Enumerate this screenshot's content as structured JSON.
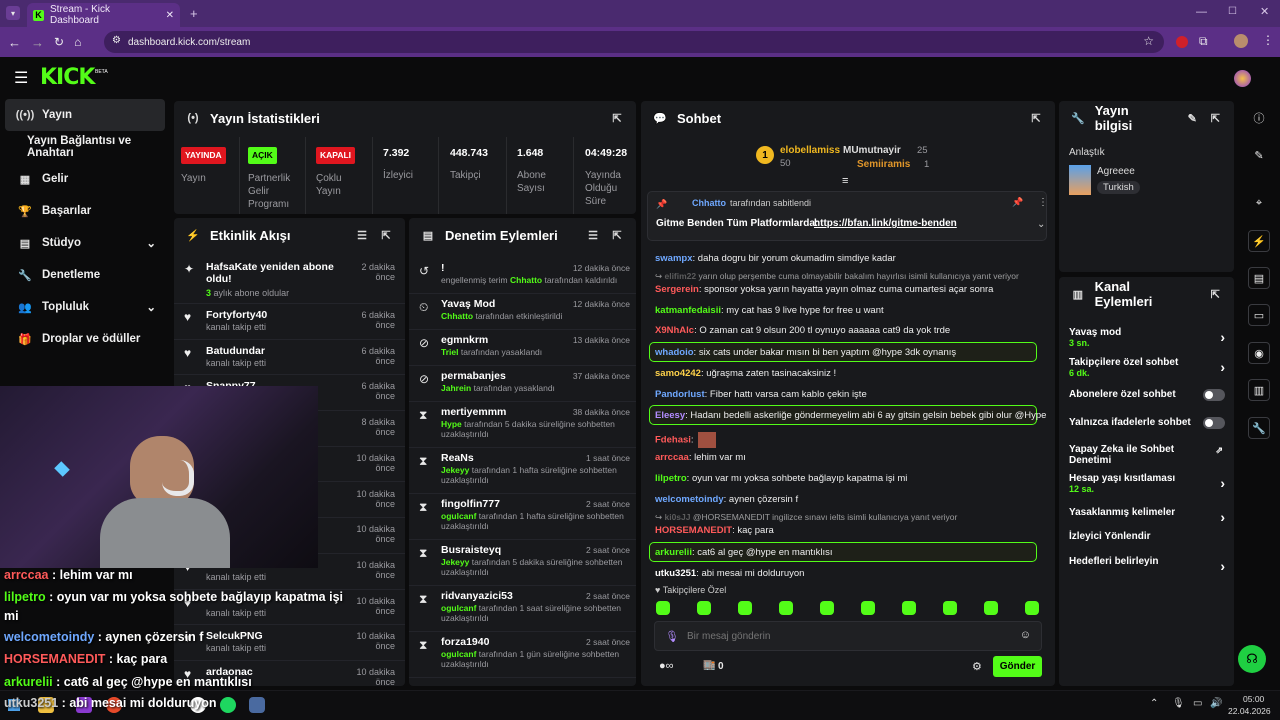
{
  "browser": {
    "tab_title": "Stream - Kick Dashboard",
    "url": "dashboard.kick.com/stream"
  },
  "header": {
    "logo": "KICK",
    "beta": "BETA"
  },
  "sidebar": {
    "items": [
      {
        "label": "Yayın",
        "icon": "broadcast-icon",
        "active": true
      },
      {
        "label": "Yayın Bağlantısı ve Anahtarı",
        "icon": "",
        "active": false
      },
      {
        "label": "Gelir",
        "icon": "revenue-icon"
      },
      {
        "label": "Başarılar",
        "icon": "trophy-icon"
      },
      {
        "label": "Stüdyo",
        "icon": "studio-icon"
      },
      {
        "label": "Denetleme",
        "icon": "wrench-icon"
      },
      {
        "label": "Topluluk",
        "icon": "community-icon"
      },
      {
        "label": "Droplar ve ödüller",
        "icon": "gift-icon"
      }
    ]
  },
  "stats": {
    "title": "Yayın İstatistikleri",
    "items": [
      {
        "badge": "YAYINDA",
        "badge_color": "#e0161f",
        "label": "Yayın"
      },
      {
        "badge": "AÇIK",
        "badge_color": "#53fc18",
        "label": "Partnerlik Gelir Programı"
      },
      {
        "badge": "KAPALI",
        "badge_color": "#e0161f",
        "label": "Çoklu Yayın"
      },
      {
        "value": "7.392",
        "label": "İzleyici"
      },
      {
        "value": "448.743",
        "label": "Takipçi"
      },
      {
        "value": "1.648",
        "label": "Abone Sayısı"
      },
      {
        "value": "04:49:28",
        "label": "Yayında Olduğu Süre"
      }
    ]
  },
  "activity": {
    "title": "Etkinlik Akışı",
    "items": [
      {
        "name": "HafsaKate yeniden abone oldu!",
        "sub_green": "3",
        "sub": "aylık abone oldular",
        "time": "2 dakika önce"
      },
      {
        "name": "Fortyforty40",
        "sub": "kanalı takip etti",
        "time": "6 dakika önce"
      },
      {
        "name": "Batudundar",
        "sub": "kanalı takip etti",
        "time": "6 dakika önce"
      },
      {
        "name": "Snappy77",
        "sub": "kanalı takip etti",
        "time": "6 dakika önce"
      },
      {
        "name": "",
        "sub": "",
        "time": "8 dakika önce"
      },
      {
        "name": "",
        "sub": "",
        "time": "10 dakika önce"
      },
      {
        "name": "",
        "sub": "",
        "time": "10 dakika önce"
      },
      {
        "name": "",
        "sub": "",
        "time": "10 dakika önce"
      },
      {
        "name": "SelcukPNG",
        "sub": "kanalı takip etti",
        "time": "10 dakika önce"
      },
      {
        "name": "",
        "sub": "kanalı takip etti",
        "time": "10 dakika önce"
      },
      {
        "name": "SelcukPNG",
        "sub": "kanalı takip etti",
        "time": "10 dakika önce"
      },
      {
        "name": "ardaonac",
        "sub": "",
        "time": "10 dakika önce"
      }
    ]
  },
  "moderation": {
    "title": "Denetim Eylemleri",
    "items": [
      {
        "name": "!",
        "user": "",
        "sub": "engellenmiş terim",
        "target": "Chhatto",
        "tail": "tarafından kaldırıldı",
        "time": "12 dakika önce",
        "icon": "undo-icon"
      },
      {
        "name": "Yavaş Mod",
        "user": "Chhatto",
        "sub": "",
        "tail": "tarafından etkinleştirildi",
        "time": "12 dakika önce",
        "icon": "slow-icon"
      },
      {
        "name": "egmnkrm",
        "user": "Triel",
        "sub": "",
        "tail": "tarafından yasaklandı",
        "time": "13 dakika önce",
        "icon": "ban-icon"
      },
      {
        "name": "permabanjes",
        "user": "Jahrein",
        "sub": "",
        "tail": "tarafından yasaklandı",
        "time": "37 dakika önce",
        "icon": "ban-icon"
      },
      {
        "name": "mertiyemmm",
        "user": "Hype",
        "sub": "",
        "tail": "tarafından 5 dakika süreliğine sohbetten uzaklaştırıldı",
        "time": "38 dakika önce",
        "icon": "hourglass-icon"
      },
      {
        "name": "ReaNs",
        "user": "Jekeyy",
        "sub": "",
        "tail": "tarafından 1 hafta süreliğine sohbetten uzaklaştırıldı",
        "time": "1 saat önce",
        "icon": "hourglass-icon"
      },
      {
        "name": "fingolfin777",
        "user": "ogulcanf",
        "sub": "",
        "tail": "tarafından 1 hafta süreliğine sohbetten uzaklaştırıldı",
        "time": "2 saat önce",
        "icon": "hourglass-icon"
      },
      {
        "name": "Busraisteyq",
        "user": "Jekeyy",
        "sub": "",
        "tail": "tarafından 5 dakika süreliğine sohbetten uzaklaştırıldı",
        "time": "2 saat önce",
        "icon": "hourglass-icon"
      },
      {
        "name": "ridvanyazici53",
        "user": "ogulcanf",
        "sub": "",
        "tail": "tarafından 1 saat süreliğine sohbetten uzaklaştırıldı",
        "time": "2 saat önce",
        "icon": "hourglass-icon"
      },
      {
        "name": "forza1940",
        "user": "ogulcanf",
        "sub": "",
        "tail": "tarafından 1 gün süreliğine sohbetten uzaklaştırıldı",
        "time": "2 saat önce",
        "icon": "hourglass-icon"
      }
    ]
  },
  "chat": {
    "title": "Sohbet",
    "top": {
      "first_rank": "1",
      "first_name": "elobellamiss",
      "first_val": "50",
      "second_name": "MUmutnayir",
      "second_val": "25",
      "third_name": "Semiiramis",
      "third_val": "1"
    },
    "pinned": {
      "by": "Chhatto",
      "by_tail": "tarafından sabitlendi",
      "text": "Gitme Benden Tüm Platformlarda:",
      "link": "https://bfan.link/gitme-benden"
    },
    "messages": [
      {
        "user": "swampx",
        "color": "#6fa8ff",
        "text": "daha dogru bir yorum okumadim simdiye kadar"
      },
      {
        "user": "elifim22",
        "color": "#888",
        "text": "yarın olup perşembe cuma olmayabilir bakalım hayırlısı isimli kullanıcıya yanıt veriyor",
        "reply": true
      },
      {
        "user": "Sergerein",
        "color": "#ff5a5a",
        "text": "sponsor yoksa yarın hayatta yayın olmaz cuma cumartesi açar sonra"
      },
      {
        "user": "katmanfedaisii",
        "color": "#53fc18",
        "text": "my cat has 9 live hype for free u want"
      },
      {
        "user": "X9NhAlc",
        "color": "#ff5a5a",
        "text": "O zaman cat 9 olsun 200 tl oynuyo aaaaaa cat9 da yok trde"
      },
      {
        "user": "whadoio",
        "color": "#6fa8ff",
        "text": "six cats under bakar mısın bi ben yaptım @hype 3dk oynanış",
        "hl": true
      },
      {
        "user": "samo4242",
        "color": "#ffd24a",
        "text": "uğraşma zaten tasinacaksiniz !"
      },
      {
        "user": "Pandorlust",
        "color": "#6fa8ff",
        "text": "Fiber hattı varsa cam kablo çekin işte"
      },
      {
        "user": "Eleesy",
        "color": "#b38cff",
        "text": "Hadanı bedelli askerliğe göndermeyelim abi 6 ay gitsin gelsin bebek gibi olur @Hype",
        "hl": true
      },
      {
        "user": "Fdehasi",
        "color": "#ff5a5a",
        "text": ""
      },
      {
        "user": "arrccaa",
        "color": "#ff5a5a",
        "text": "lehim var mı"
      },
      {
        "user": "lilpetro",
        "color": "#53fc18",
        "text": "oyun var mı yoksa sohbete bağlayıp kapatma işi mi"
      },
      {
        "user": "welcometoindy",
        "color": "#6fa8ff",
        "text": "aynen çözersin f"
      },
      {
        "user": "ki0sJJ",
        "color": "#888",
        "text": "@HORSEMANEDIT ingilizce sınavı ielts isimli kullanıcıya yanıt veriyor",
        "reply": true
      },
      {
        "user": "HORSEMANEDIT",
        "color": "#ff5a5a",
        "text": "kaç para"
      },
      {
        "user": "arkurelii",
        "color": "#53fc18",
        "text": "cat6 al geç @hype en mantıklısı",
        "hl": true
      },
      {
        "user": "utku3251",
        "color": "#fff",
        "text": "abi mesai mi dolduruyon"
      }
    ],
    "follower_only": "Takipçilere Özel",
    "input_placeholder": "Bir mesaj gönderin",
    "points": "0",
    "send": "Gönder"
  },
  "stream_info": {
    "title": "Yayın bilgisi",
    "category_label": "Anlaştık",
    "game": "Agreeee",
    "language": "Turkish"
  },
  "channel_actions": {
    "title": "Kanal Eylemleri",
    "items": [
      {
        "label": "Yavaş mod",
        "sub": "3 sn.",
        "control": "chevron"
      },
      {
        "label": "Takipçilere özel sohbet",
        "sub": "6 dk.",
        "control": "chevron"
      },
      {
        "label": "Abonelere özel sohbet",
        "sub": "",
        "control": "toggle"
      },
      {
        "label": "Yalnızca ifadelerle sohbet",
        "sub": "",
        "control": "toggle"
      },
      {
        "label": "Yapay Zeka ile Sohbet Denetimi",
        "sub": "",
        "control": "external"
      },
      {
        "label": "Hesap yaşı kısıtlaması",
        "sub": "12 sa.",
        "control": "chevron"
      },
      {
        "label": "Yasaklanmış kelimeler",
        "sub": "",
        "control": "chevron"
      },
      {
        "label": "İzleyici Yönlendir",
        "sub": "",
        "control": ""
      },
      {
        "label": "Hedefleri belirleyin",
        "sub": "",
        "control": "chevron"
      }
    ]
  },
  "overlay": {
    "lines": [
      {
        "user": "arrccaa",
        "ucolor": "#ff5a5a",
        "text": "lehim var mı"
      },
      {
        "user": "lilpetro",
        "ucolor": "#53fc18",
        "text": "oyun var mı yoksa sohbete bağlayıp kapatma işi"
      },
      {
        "user": "",
        "ucolor": "#fff",
        "text": "mi"
      },
      {
        "user": "welcometoindy",
        "ucolor": "#6fa8ff",
        "text": "aynen çözersin f"
      },
      {
        "user": "HORSEMANEDIT",
        "ucolor": "#ff5a5a",
        "text": "kaç para"
      },
      {
        "user": "arkurelii",
        "ucolor": "#53fc18",
        "text": "cat6 al geç @hype en mantıklısı"
      },
      {
        "user": "utku3251",
        "ucolor": "#ccc",
        "text": "abi mesai mi dolduruyon"
      }
    ]
  },
  "taskbar": {
    "time": "05:00",
    "date": "22.04.2026"
  }
}
